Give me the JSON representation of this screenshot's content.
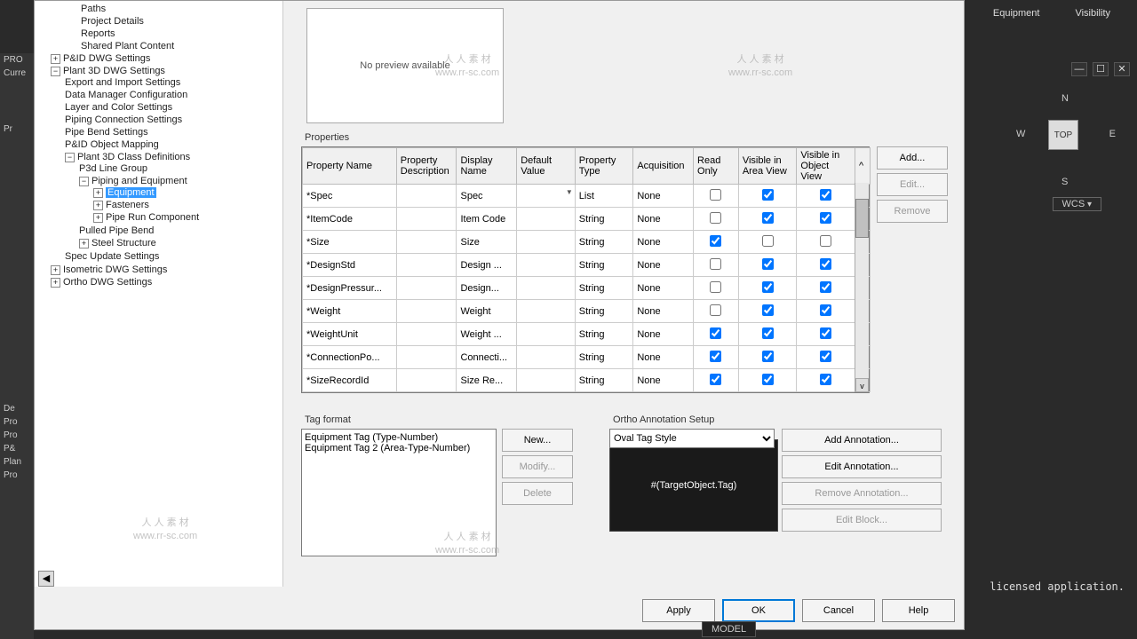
{
  "header": {
    "equipment": "Equipment",
    "visibility": "Visibility"
  },
  "left_fragments": {
    "pro": "PRO",
    "curr": "Curre",
    "pr": "Pr",
    "de": "De",
    "p1": "Pro",
    "p2": "Pro",
    "p3": "P&",
    "p4": "Plan",
    "p5": "Pro"
  },
  "tree": {
    "paths": "Paths",
    "project_details": "Project Details",
    "reports": "Reports",
    "shared": "Shared Plant Content",
    "pid_dwg": "P&ID DWG Settings",
    "p3d_dwg": "Plant 3D DWG Settings",
    "exp": "Export and Import Settings",
    "dmc": "Data Manager Configuration",
    "layer": "Layer and Color Settings",
    "pcs": "Piping Connection Settings",
    "pbs": "Pipe Bend Settings",
    "pom": "P&ID Object Mapping",
    "pcd": "Plant 3D Class Definitions",
    "p3line": "P3d Line Group",
    "pae": "Piping and Equipment",
    "equip": "Equipment",
    "fast": "Fasteners",
    "prc": "Pipe Run Component",
    "ppb": "Pulled Pipe Bend",
    "steel": "Steel Structure",
    "sus": "Spec Update Settings",
    "iso": "Isometric DWG Settings",
    "ortho": "Ortho DWG Settings"
  },
  "preview": {
    "none": "No preview available"
  },
  "props_label": "Properties",
  "cols": {
    "name": "Property Name",
    "desc": "Property Description",
    "disp": "Display Name",
    "def": "Default Value",
    "type": "Property Type",
    "acq": "Acquisition",
    "ro": "Read Only",
    "vav": "Visible in Area View",
    "vov": "Visible in Object View"
  },
  "rows": [
    {
      "name": "*Spec",
      "disp": "Spec",
      "type": "List",
      "acq": "None",
      "ro": false,
      "vav": true,
      "vov": true,
      "dd": true
    },
    {
      "name": "*ItemCode",
      "disp": "Item Code",
      "type": "String",
      "acq": "None",
      "ro": false,
      "vav": true,
      "vov": true
    },
    {
      "name": "*Size",
      "disp": "Size",
      "type": "String",
      "acq": "None",
      "ro": true,
      "vav": false,
      "vov": false
    },
    {
      "name": "*DesignStd",
      "disp": "Design ...",
      "type": "String",
      "acq": "None",
      "ro": false,
      "vav": true,
      "vov": true
    },
    {
      "name": "*DesignPressur...",
      "disp": "Design...",
      "type": "String",
      "acq": "None",
      "ro": false,
      "vav": true,
      "vov": true
    },
    {
      "name": "*Weight",
      "disp": "Weight",
      "type": "String",
      "acq": "None",
      "ro": false,
      "vav": true,
      "vov": true
    },
    {
      "name": "*WeightUnit",
      "disp": "Weight ...",
      "type": "String",
      "acq": "None",
      "ro": true,
      "vav": true,
      "vov": true
    },
    {
      "name": "*ConnectionPo...",
      "disp": "Connecti...",
      "type": "String",
      "acq": "None",
      "ro": true,
      "vav": true,
      "vov": true
    },
    {
      "name": "*SizeRecordId",
      "disp": "Size Re...",
      "type": "String",
      "acq": "None",
      "ro": true,
      "vav": true,
      "vov": true
    }
  ],
  "btns": {
    "add": "Add...",
    "edit": "Edit...",
    "remove": "Remove"
  },
  "tag": {
    "label": "Tag format",
    "l1": "Equipment Tag (Type-Number)",
    "l2": "Equipment Tag 2 (Area-Type-Number)",
    "new": "New...",
    "modify": "Modify...",
    "delete": "Delete"
  },
  "ortho": {
    "label": "Ortho Annotation Setup",
    "style": "Oval Tag Style",
    "expr": "#(TargetObject.Tag)",
    "add": "Add Annotation...",
    "edit": "Edit Annotation...",
    "remove": "Remove Annotation...",
    "block": "Edit Block..."
  },
  "dlg": {
    "apply": "Apply",
    "ok": "OK",
    "cancel": "Cancel",
    "help": "Help"
  },
  "cube": {
    "top": "TOP",
    "n": "N",
    "s": "S",
    "w": "W",
    "e": "E",
    "wcs": "WCS"
  },
  "status": {
    "model": "MODEL",
    "lic": "licensed application."
  },
  "wm": {
    "cn": "人 人 素 材",
    "url": "www.rr-sc.com"
  }
}
